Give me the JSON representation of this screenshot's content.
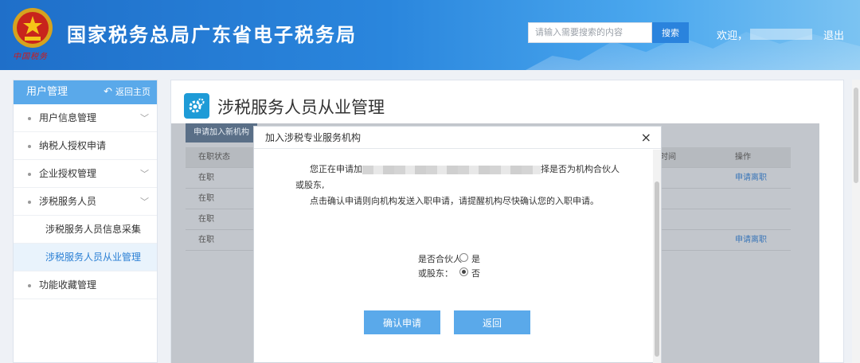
{
  "header": {
    "emblem_caption": "中国税务",
    "title": "国家税务总局广东省电子税务局",
    "search_placeholder": "请输入需要搜索的内容",
    "search_button": "搜索",
    "welcome": "欢迎，",
    "logout": "退出"
  },
  "sidebar": {
    "title": "用户管理",
    "back_home": "返回主页",
    "items": [
      {
        "label": "用户信息管理",
        "has_chevron": true
      },
      {
        "label": "纳税人授权申请",
        "has_chevron": false
      },
      {
        "label": "企业授权管理",
        "has_chevron": true
      },
      {
        "label": "涉税服务人员",
        "has_chevron": true
      }
    ],
    "sub_items": [
      {
        "label": "涉税服务人员信息采集",
        "active": false
      },
      {
        "label": "涉税服务人员从业管理",
        "active": true
      }
    ],
    "last_item": {
      "label": "功能收藏管理"
    }
  },
  "main": {
    "page_title": "涉税服务人员从业管理",
    "new_button": "申请加入新机构",
    "table": {
      "headers": {
        "status": "在职状态",
        "time": "时间",
        "op": "操作"
      },
      "rows": [
        {
          "status": "在职",
          "op": "申请离职"
        },
        {
          "status": "在职",
          "op": ""
        },
        {
          "status": "在职",
          "op": ""
        },
        {
          "status": "在职",
          "op": "申请离职"
        }
      ]
    }
  },
  "modal": {
    "title": "加入涉税专业服务机构",
    "close": "×",
    "msg_line1_prefix": "您正在申请加",
    "msg_line1_suffix": "择是否为机构合伙人",
    "msg_line2": "或股东,",
    "msg_line3": "点击确认申请则向机构发送入职申请，请提醒机构尽快确认您的入职申请。",
    "partner_label_line1": "是否合伙人",
    "partner_label_line2": "或股东：",
    "option_yes": "是",
    "option_no": "否",
    "selected": "否",
    "confirm_button": "确认申请",
    "back_button": "返回"
  },
  "colors": {
    "header_blue": "#2a86dd",
    "accent": "#5aa9ea",
    "link": "#3a76b8"
  }
}
